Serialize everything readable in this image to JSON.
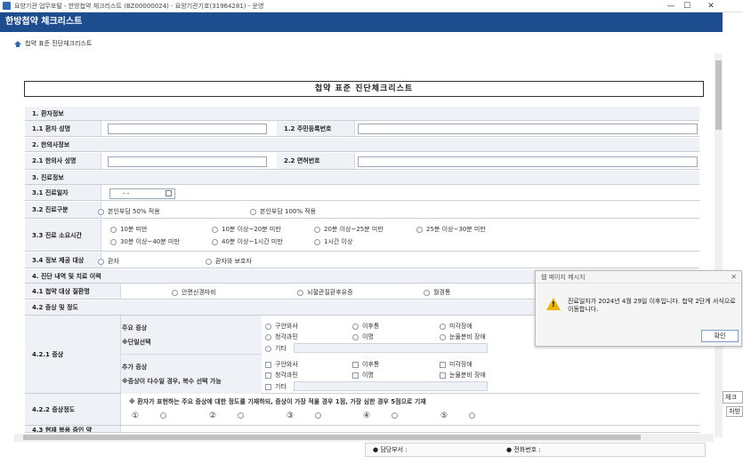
{
  "window": {
    "title": "요양기관 업무포털 - 한방첩약 체크리스트 (BZ00000024) - 요양기관기호(31964281) - 운영",
    "controls": [
      "—",
      "☐",
      "✕"
    ]
  },
  "header": {
    "title": "한방첩약 체크리스트"
  },
  "breadcrumb": "첩약 표준 진단체크리스트",
  "doc_title": "첩약 표준 진단체크리스트",
  "sections": {
    "s1": "1. 환자정보",
    "s1_1": "1.1 환자 성명",
    "s1_2": "1.2 주민등록번호",
    "s2": "2. 한의사정보",
    "s2_1": "2.1 한의사 성명",
    "s2_2": "2.2 면허번호",
    "s3": "3. 진료정보",
    "s3_1": "3.1 진료일자",
    "s3_2": "3.2 진료구분",
    "s3_3": "3.3 진료 소요시간",
    "s3_4": "3.4 정보 제공 대상",
    "s4": "4. 진단 내역 및 치료 이력",
    "s4_1": "4.1 첩약 대상 질환명",
    "s4_2": "4.2 증상 및 정도",
    "s4_2_1": "4.2.1 증상",
    "s4_2_2": "4.2.2 증상정도",
    "s4_3": "4.3 현재 복용 중인 약"
  },
  "date_placeholder": "- -",
  "care_type": [
    "본인부담 50% 적용",
    "본인부담 100% 적용"
  ],
  "duration": [
    "10분 미만",
    "10분 이상~20분 미만",
    "20분 이상~25분 미만",
    "25분 이상~30분 미만",
    "30분 이상~40분 미만",
    "40분 이상~1시간 미만",
    "1시간 이상"
  ],
  "info_target": [
    "환자",
    "환자와 보호자"
  ],
  "diseases": [
    "안면신경마비",
    "뇌혈관질환후유증",
    "월경통"
  ],
  "main_symptom": {
    "label": "주요 증상",
    "note": "※단일선택",
    "options": [
      "구안와사",
      "이후통",
      "미각장애",
      "청각과민",
      "이명",
      "눈물분비 장애",
      "기타"
    ]
  },
  "extra_symptom": {
    "label": "추가 증상",
    "note": "※증상이 다수일 경우, 복수 선택 가능",
    "options": [
      "구안와사",
      "이후통",
      "미각장애",
      "청각과민",
      "이명",
      "눈물분비 장애",
      "기타"
    ]
  },
  "severity": {
    "note": "※ 환자가 표현하는 주요 증상에 대한 정도를 기재하되, 증상이 가장 적을 경우 1점, 가장 심한 경우 5점으로 기재",
    "scale": [
      "①",
      "②",
      "③",
      "④",
      "⑤"
    ]
  },
  "dialog": {
    "title": "웹 페이지 메시지",
    "message": "진료일자가 2024년 4월 29일 이후입니다. 첩약 2단계 서식으로 이동합니다.",
    "ok": "확인"
  },
  "footer": {
    "dept": "● 담당부서 :",
    "phone": "● 전화번호 :"
  },
  "side": {
    "a": "체크리",
    "b": "처방일"
  }
}
